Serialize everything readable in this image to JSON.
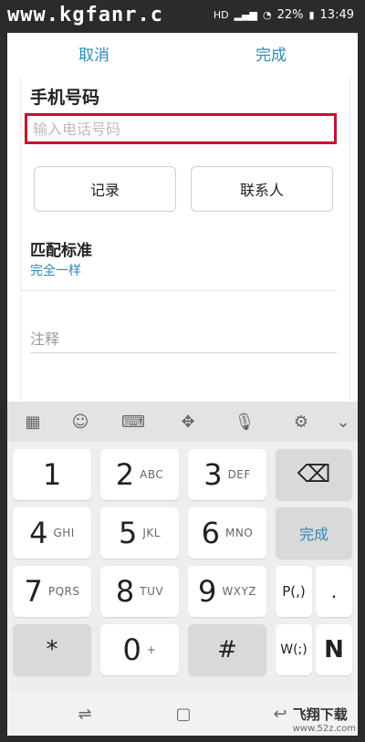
{
  "status": {
    "watermark": "www.kgfanr.c",
    "battery": "22%",
    "time": "13:49",
    "network_badge": "HD"
  },
  "top": {
    "cancel": "取消",
    "done": "完成"
  },
  "form": {
    "title": "手机号码",
    "phone_placeholder": "输入电话号码",
    "btn_log": "记录",
    "btn_contact": "联系人",
    "match_title": "匹配标准",
    "match_value": "完全一样",
    "note_placeholder": "注释"
  },
  "keyboard": {
    "toolbar_icons": [
      "emoji-grid-icon",
      "smiley-icon",
      "keyboard-icon",
      "move-icon",
      "mic-icon",
      "settings-icon",
      "chevron-down-icon"
    ],
    "keys": [
      {
        "digit": "1",
        "letters": ""
      },
      {
        "digit": "2",
        "letters": "ABC"
      },
      {
        "digit": "3",
        "letters": "DEF"
      },
      {
        "digit": "4",
        "letters": "GHI"
      },
      {
        "digit": "5",
        "letters": "JKL"
      },
      {
        "digit": "6",
        "letters": "MNO"
      },
      {
        "digit": "7",
        "letters": "PQRS"
      },
      {
        "digit": "8",
        "letters": "TUV"
      },
      {
        "digit": "9",
        "letters": "WXYZ"
      },
      {
        "digit": "0",
        "letters": "+"
      }
    ],
    "done": "完成",
    "pause": "P(,)",
    "dot": ".",
    "wait": "W(;)",
    "n": "N",
    "star": "*",
    "hash": "#"
  },
  "bottom_wm": {
    "brand": "飞翔下载",
    "url": "www.52z.com"
  },
  "colors": {
    "accent": "#2d8ab5",
    "highlight": "#c8102e"
  }
}
